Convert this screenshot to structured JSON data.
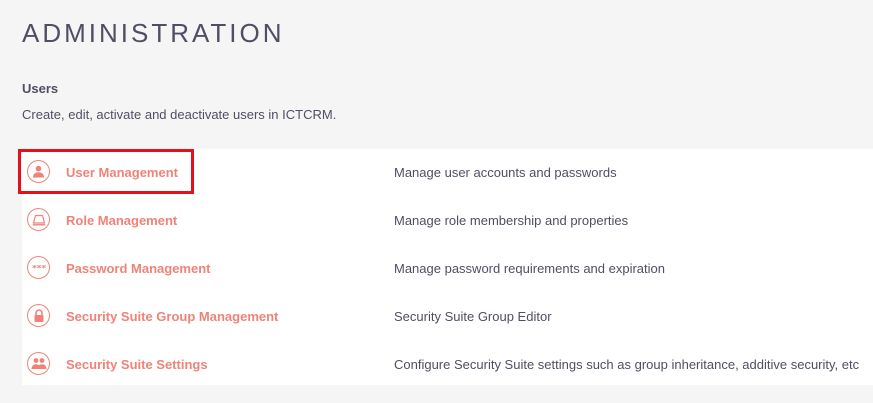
{
  "page": {
    "title": "ADMINISTRATION"
  },
  "section": {
    "title": "Users",
    "description": "Create, edit, activate and deactivate users in ICTCRM."
  },
  "rows": [
    {
      "icon": "user-icon",
      "label": "User Management",
      "description": "Manage user accounts and passwords"
    },
    {
      "icon": "role-icon",
      "label": "Role Management",
      "description": "Manage role membership and properties"
    },
    {
      "icon": "password-icon",
      "label": "Password Management",
      "description": "Manage password requirements and expiration"
    },
    {
      "icon": "lock-icon",
      "label": "Security Suite Group Management",
      "description": "Security Suite Group Editor"
    },
    {
      "icon": "group-icon",
      "label": "Security Suite Settings",
      "description": "Configure Security Suite settings such as group inheritance, additive security, etc"
    }
  ],
  "colors": {
    "accent": "#f08377",
    "text": "#534d64",
    "highlight": "#e4101c",
    "background": "#f5f5f5"
  }
}
